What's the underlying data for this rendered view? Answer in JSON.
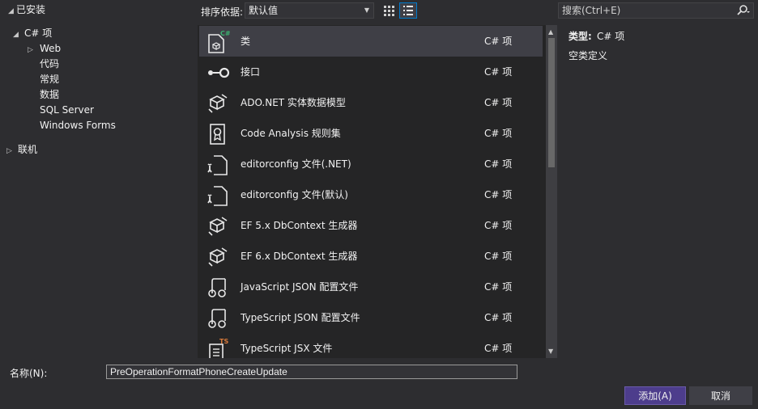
{
  "tree": {
    "installed": "已安装",
    "csharp": "C# 项",
    "children": [
      "Web",
      "代码",
      "常规",
      "数据",
      "SQL Server",
      "Windows Forms"
    ],
    "online": "联机"
  },
  "toolbar": {
    "sort_label": "排序依据:",
    "sort_value": "默认值",
    "search_placeholder": "搜索(Ctrl+E)"
  },
  "items": [
    {
      "name": "类",
      "type": "C# 项",
      "icon": "class-icon"
    },
    {
      "name": "接口",
      "type": "C# 项",
      "icon": "interface-icon"
    },
    {
      "name": "ADO.NET 实体数据模型",
      "type": "C# 项",
      "icon": "data-model-icon"
    },
    {
      "name": "Code Analysis 规则集",
      "type": "C# 项",
      "icon": "ruleset-icon"
    },
    {
      "name": "editorconfig 文件(.NET)",
      "type": "C# 项",
      "icon": "config-file-icon"
    },
    {
      "name": "editorconfig 文件(默认)",
      "type": "C# 项",
      "icon": "config-file-icon"
    },
    {
      "name": "EF 5.x DbContext 生成器",
      "type": "C# 项",
      "icon": "data-model-icon"
    },
    {
      "name": "EF 6.x DbContext 生成器",
      "type": "C# 项",
      "icon": "data-model-icon"
    },
    {
      "name": "JavaScript JSON 配置文件",
      "type": "C# 项",
      "icon": "json-file-icon"
    },
    {
      "name": "TypeScript JSON 配置文件",
      "type": "C# 项",
      "icon": "json-file-icon"
    },
    {
      "name": "TypeScript JSX 文件",
      "type": "C# 项",
      "icon": "tsx-file-icon"
    }
  ],
  "details": {
    "type_label": "类型:",
    "type_value": "C# 项",
    "description": "空类定义"
  },
  "footer": {
    "name_label": "名称(N):",
    "name_value": "PreOperationFormatPhoneCreateUpdate",
    "add_button": "添加(A)",
    "cancel_button": "取消"
  },
  "colors": {
    "background": "#2d2d30",
    "list_background": "#252526",
    "selected_row": "#3f3f46",
    "primary_button": "#4d3d8c",
    "csharp_badge": "#3cb371",
    "ts_badge": "#d97a3a"
  }
}
